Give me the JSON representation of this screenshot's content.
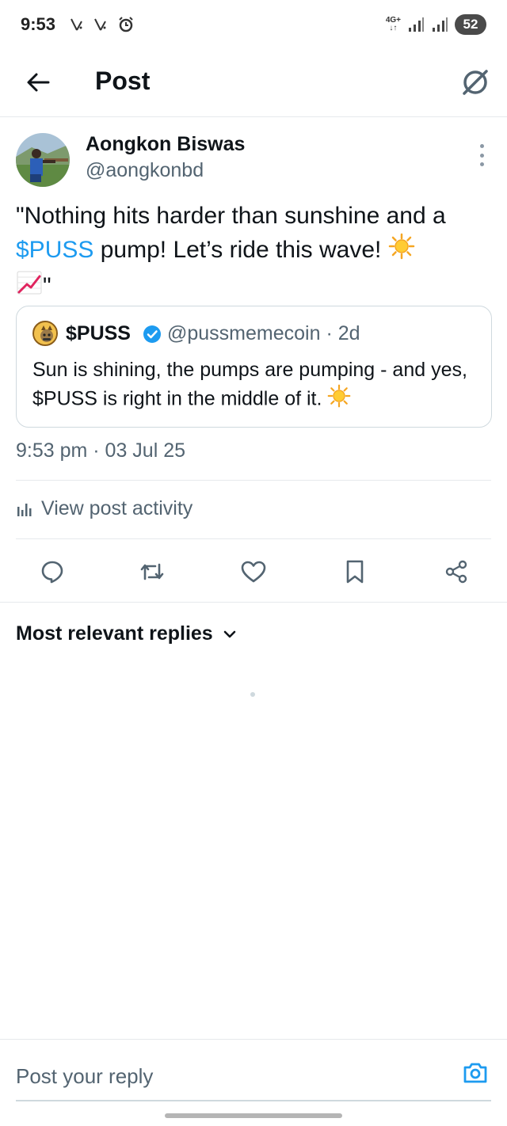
{
  "status_bar": {
    "time": "9:53",
    "network": "4G+",
    "battery": "52"
  },
  "header": {
    "title": "Post"
  },
  "post": {
    "author_name": "Aongkon Biswas",
    "author_handle": "@aongkonbd",
    "text_before": "\"Nothing hits harder than sunshine and a ",
    "cashtag": "$PUSS",
    "text_after": " pump! Let’s ride this wave! ",
    "emoji_sun": "☀️",
    "emoji_chart": "📈",
    "text_end": "\"",
    "timestamp": "9:53 pm · 03 Jul 25"
  },
  "quote": {
    "name": "$PUSS",
    "handle": "@pussmemecoin · 2d",
    "text": "Sun is shining, the pumps are pumping - and yes, $PUSS is right in the middle of it. ",
    "emoji_sun": "☀️"
  },
  "activity": {
    "label": "View post activity"
  },
  "actions": [
    "reply",
    "repost",
    "like",
    "bookmark",
    "share"
  ],
  "replies": {
    "sort_label": "Most relevant replies"
  },
  "reply_bar": {
    "placeholder": "Post your reply"
  },
  "colors": {
    "accent": "#1d9bf0",
    "text_primary": "#0f1419",
    "text_secondary": "#536471",
    "divider": "#e6e9ec"
  }
}
